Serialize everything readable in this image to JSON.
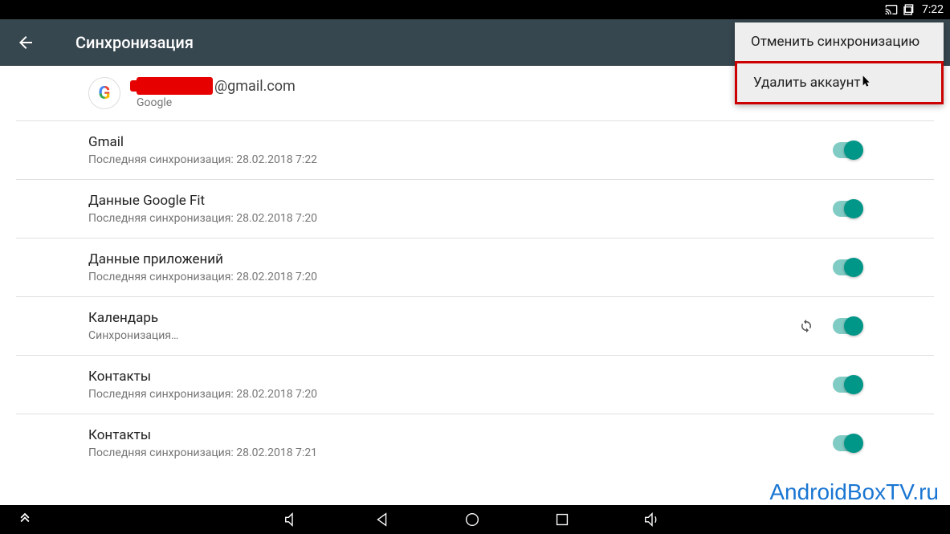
{
  "status_bar": {
    "time": "7:22"
  },
  "app_bar": {
    "title": "Синхронизация"
  },
  "dropdown": {
    "cancel_sync": "Отменить синхронизацию",
    "delete_account": "Удалить аккаунт"
  },
  "account": {
    "email_suffix": "@gmail.com",
    "provider": "Google"
  },
  "sync_items": [
    {
      "title": "Gmail",
      "subtitle": "Последняя синхронизация: 28.02.2018 7:22",
      "syncing": false
    },
    {
      "title": "Данные Google Fit",
      "subtitle": "Последняя синхронизация: 28.02.2018 7:20",
      "syncing": false
    },
    {
      "title": "Данные приложений",
      "subtitle": "Последняя синхронизация: 28.02.2018 7:20",
      "syncing": false
    },
    {
      "title": "Календарь",
      "subtitle": "Синхронизация…",
      "syncing": true
    },
    {
      "title": "Контакты",
      "subtitle": "Последняя синхронизация: 28.02.2018 7:20",
      "syncing": false
    },
    {
      "title": "Контакты",
      "subtitle": "Последняя синхронизация: 28.02.2018 7:21",
      "syncing": false
    }
  ],
  "watermark": "AndroidBoxTV.ru"
}
